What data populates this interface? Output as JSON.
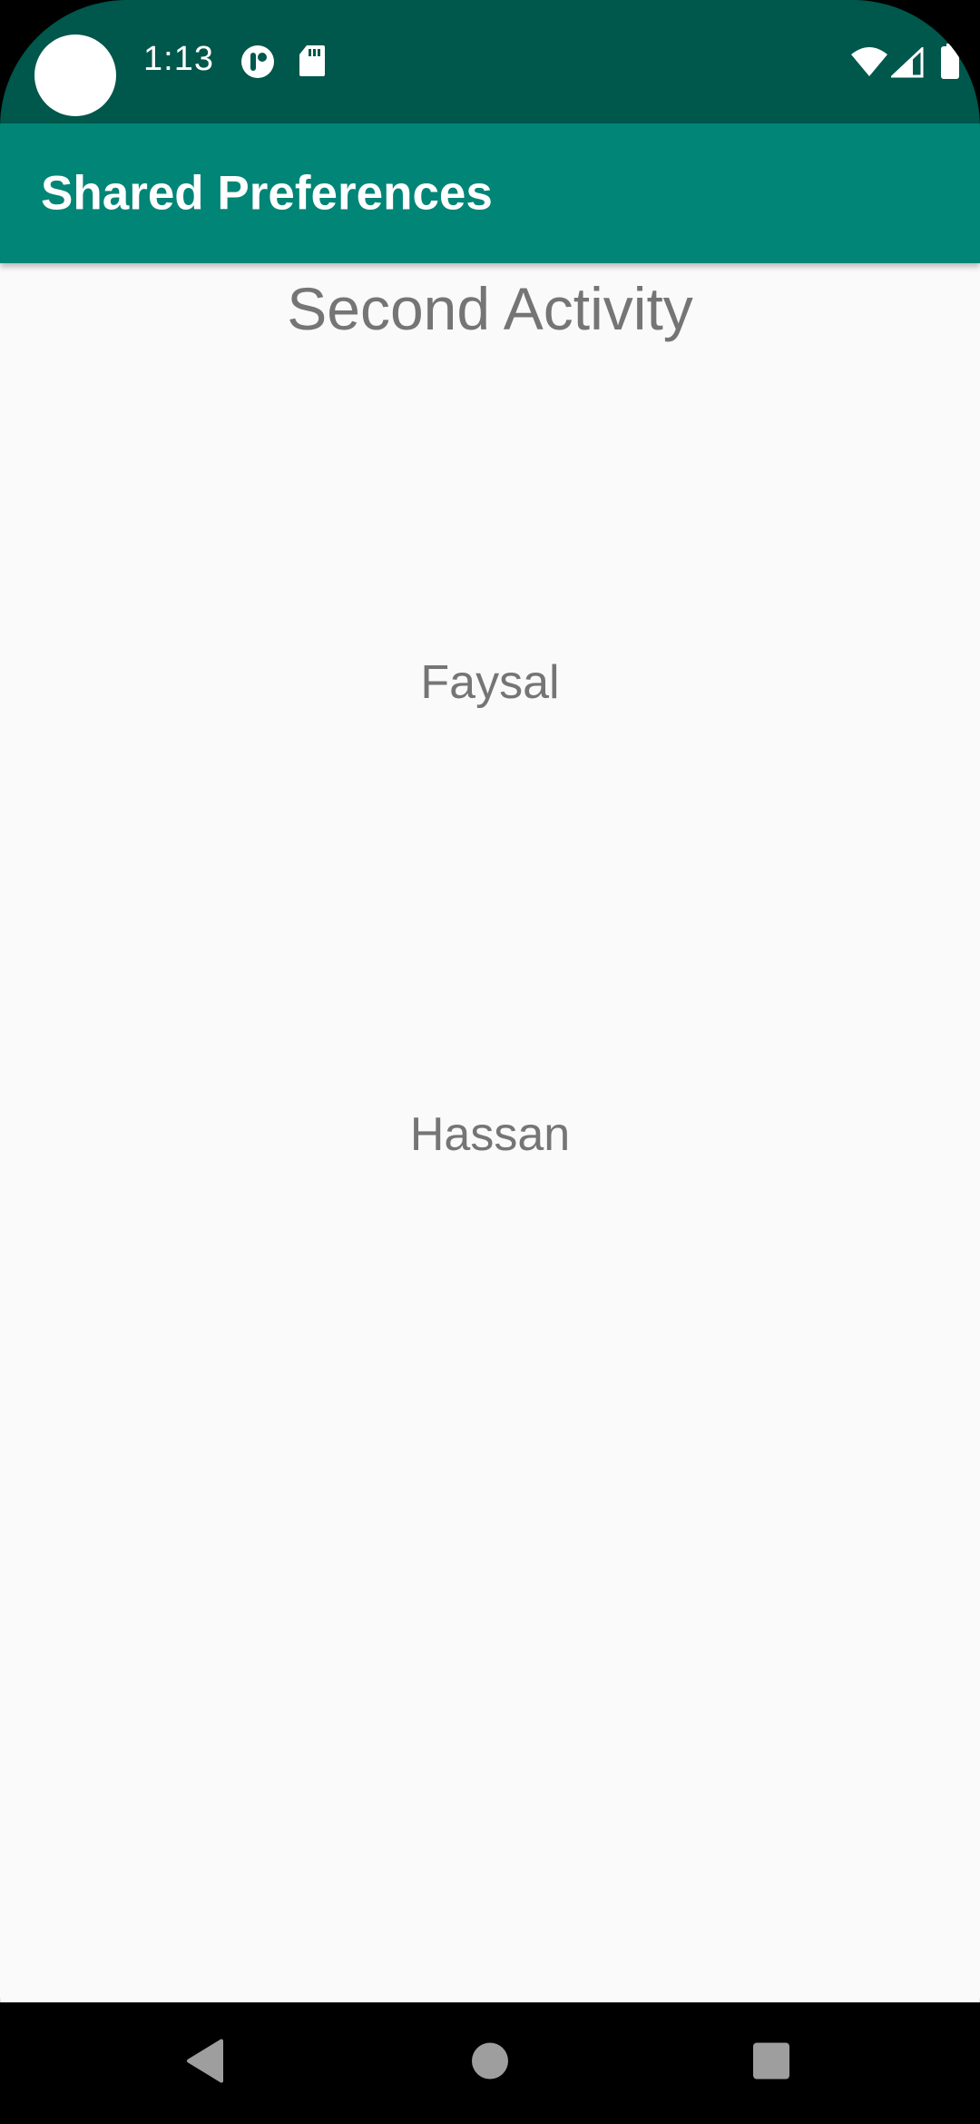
{
  "status_bar": {
    "time": "1:13",
    "icons": [
      "camera-cutout",
      "app-notification-icon",
      "sd-card-icon",
      "wifi-icon",
      "cellular-signal-icon",
      "battery-icon"
    ],
    "background_color": "#00574b"
  },
  "app_bar": {
    "title": "Shared Preferences",
    "background_color": "#008577"
  },
  "content": {
    "heading": "Second Activity",
    "first_value": "Faysal",
    "second_value": "Hassan",
    "text_color": "#757575",
    "background_color": "#fafafa"
  },
  "nav_bar": {
    "buttons": [
      "back-icon",
      "home-icon",
      "recents-icon"
    ]
  }
}
